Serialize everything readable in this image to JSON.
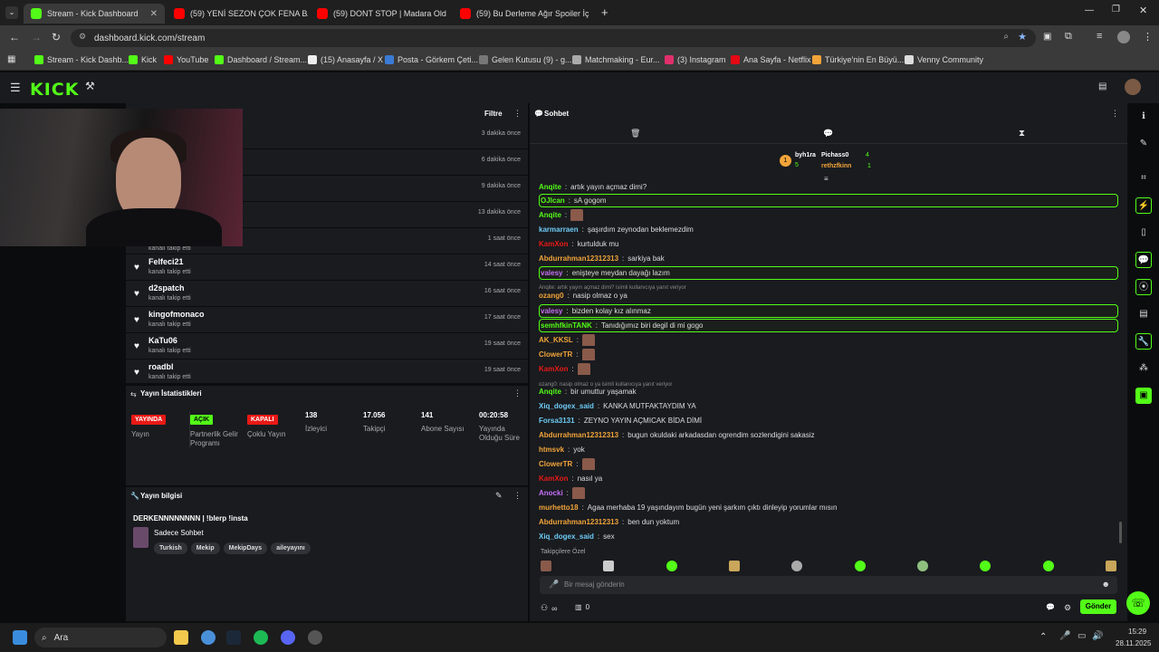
{
  "browser": {
    "tabs": [
      {
        "title": "Stream - Kick Dashboard",
        "color": "#53fc18"
      },
      {
        "title": "(59) YENİ SEZON ÇOK FENA BA",
        "color": "#ff0000"
      },
      {
        "title": "(59) DONT STOP | Madara Old",
        "color": "#ff0000"
      },
      {
        "title": "(59) Bu Derleme Ağır Spoiler İç",
        "color": "#ff0000"
      }
    ],
    "url": "dashboard.kick.com/stream",
    "bookmarks": [
      "Stream - Kick Dashb...",
      "Kick",
      "YouTube",
      "Dashboard / Stream...",
      "(15) Anasayfa / X",
      "Posta - Görkem Çeti...",
      "Gelen Kutusu (9) - g...",
      "Matchmaking - Eur...",
      "(3) Instagram",
      "Ana Sayfa - Netflix",
      "Türkiye'nin En Büyü...",
      "Venny Community"
    ]
  },
  "brand": {
    "logo": "KICK",
    "accent": "#53fc18"
  },
  "feed": {
    "filter_label": "Filtre",
    "rows": [
      {
        "name": "",
        "sub": "",
        "time": "3 dakika önce"
      },
      {
        "name": "",
        "sub": "",
        "time": "6 dakika önce"
      },
      {
        "name": "",
        "sub": "",
        "time": "9 dakika önce"
      },
      {
        "name": "",
        "sub": "",
        "time": "13 dakika önce"
      },
      {
        "name": "",
        "sub": "kanalı takip etti",
        "time": "1 saat önce"
      },
      {
        "name": "Felfeci21",
        "sub": "kanalı takip etti",
        "time": "14 saat önce"
      },
      {
        "name": "d2spatch",
        "sub": "kanalı takip etti",
        "time": "16 saat önce"
      },
      {
        "name": "kingofmonaco",
        "sub": "kanalı takip etti",
        "time": "17 saat önce"
      },
      {
        "name": "KaTu06",
        "sub": "kanalı takip etti",
        "time": "19 saat önce"
      },
      {
        "name": "roadbl",
        "sub": "kanalı takip etti",
        "time": "19 saat önce"
      }
    ]
  },
  "stats": {
    "title": "Yayın İstatistikleri",
    "items": [
      {
        "badge": "YAYINDA",
        "badge_color": "#e91916",
        "label": "Yayın"
      },
      {
        "badge": "AÇIK",
        "badge_color": "#53fc18",
        "label": "Partnerlik Gelir Programı"
      },
      {
        "badge": "KAPALI",
        "badge_color": "#e91916",
        "label": "Çoklu Yayın"
      },
      {
        "value": "138",
        "label": "İzleyici"
      },
      {
        "value": "17.056",
        "label": "Takipçi"
      },
      {
        "value": "141",
        "label": "Abone Sayısı"
      },
      {
        "value": "00:20:58",
        "label": "Yayında Olduğu Süre"
      }
    ]
  },
  "stream_info": {
    "title": "Yayın bilgisi",
    "stream_title": "DERKENNNNNNNN | !blerp !insta",
    "category": "Sadece Sohbet",
    "tags": [
      "Turkish",
      "Mekip",
      "MekipDays",
      "aileyayını"
    ]
  },
  "chat": {
    "title": "Sohbet",
    "leaderboard": [
      {
        "name": "byh1ra",
        "count": "5"
      },
      {
        "name": "Pichass0",
        "count": "4"
      },
      {
        "name": "rethzfkinn",
        "count": "1"
      }
    ],
    "messages": [
      {
        "user": "Anqite",
        "text": "artık yayın açmaz dimi?",
        "color": "#53fc18",
        "type": "msg"
      },
      {
        "user": "OJlcan",
        "text": "sA gogom",
        "color": "#53fc18",
        "type": "hl"
      },
      {
        "user": "Anqite",
        "text": "",
        "color": "#53fc18",
        "type": "emote"
      },
      {
        "user": "karmarraen",
        "text": "şaşırdım zeynodan beklemezdim",
        "color": "#6ecbf5",
        "type": "msg"
      },
      {
        "user": "KamXon",
        "text": "kurtulduk mu",
        "color": "#e91916",
        "type": "msg"
      },
      {
        "user": "Abdurrahman12312313",
        "text": "sarkiya bak",
        "color": "#f2a43a",
        "type": "msg"
      },
      {
        "user": "valesy",
        "text": "enişteye meydan dayağı lazım",
        "color": "#c46ef5",
        "type": "hl"
      },
      {
        "user": "",
        "text": "Anqite: artık yayın açmaz dimi? isimli kullanıcıya yanıt veriyor",
        "color": "#888",
        "type": "reply"
      },
      {
        "user": "ozang0",
        "text": "nasip olmaz o ya",
        "color": "#f2a43a",
        "type": "msg"
      },
      {
        "user": "valesy",
        "text": "bizden kolay kız alınmaz",
        "color": "#c46ef5",
        "type": "hl"
      },
      {
        "user": "semhfkinTANK",
        "text": "Tanıdığımız biri degil di mi gogo",
        "color": "#53fc18",
        "type": "hl"
      },
      {
        "user": "AK_KKSL",
        "text": "",
        "color": "#f2a43a",
        "type": "emote"
      },
      {
        "user": "ClowerTR",
        "text": "",
        "color": "#f2a43a",
        "type": "emote"
      },
      {
        "user": "KamXon",
        "text": "",
        "color": "#e91916",
        "type": "emote"
      },
      {
        "user": "",
        "text": "ozang0: nasip olmaz o ya isimli kullanıcıya yanıt veriyor",
        "color": "#888",
        "type": "reply"
      },
      {
        "user": "Anqite",
        "text": "bir umuttur yaşamak",
        "color": "#53fc18",
        "type": "msg"
      },
      {
        "user": "Xiq_dogex_said",
        "text": "KANKA MUTFAKTAYDIM YA",
        "color": "#6ecbf5",
        "type": "msg"
      },
      {
        "user": "Forsa3131",
        "text": "ZEYNO YAYIN AÇMICAK BİDA DİMİ",
        "color": "#6ecbf5",
        "type": "msg"
      },
      {
        "user": "Abdurrahman12312313",
        "text": "bugun okuldaki arkadasdan ogrendim sozlendigini sakasiz",
        "color": "#f2a43a",
        "type": "msg"
      },
      {
        "user": "htmsvk",
        "text": "yok",
        "color": "#f2a43a",
        "type": "msg"
      },
      {
        "user": "ClowerTR",
        "text": "",
        "color": "#f2a43a",
        "type": "emote"
      },
      {
        "user": "KamXon",
        "text": "nasıl ya",
        "color": "#e91916",
        "type": "msg"
      },
      {
        "user": "Anocki",
        "text": "",
        "color": "#c46ef5",
        "type": "emote"
      },
      {
        "user": "murhetto18",
        "text": "Agaa merhaba 19 yaşındayım bugün yeni şarkım çıktı dinleyip yorumlar mısın",
        "color": "#f2a43a",
        "type": "msg"
      },
      {
        "user": "Abdurrahman12312313",
        "text": "ben dun yoktum",
        "color": "#f2a43a",
        "type": "msg"
      },
      {
        "user": "Xiq_dogex_said",
        "text": "sex",
        "color": "#6ecbf5",
        "type": "msg"
      }
    ],
    "followers_only_label": "Takipçilere Özel",
    "input_placeholder": "Bir mesaj gönderin",
    "send_label": "Gönder",
    "points": "∞",
    "wallet": "0"
  },
  "taskbar": {
    "search_label": "Ara",
    "time": "15:29",
    "date": "28.11.2025"
  }
}
